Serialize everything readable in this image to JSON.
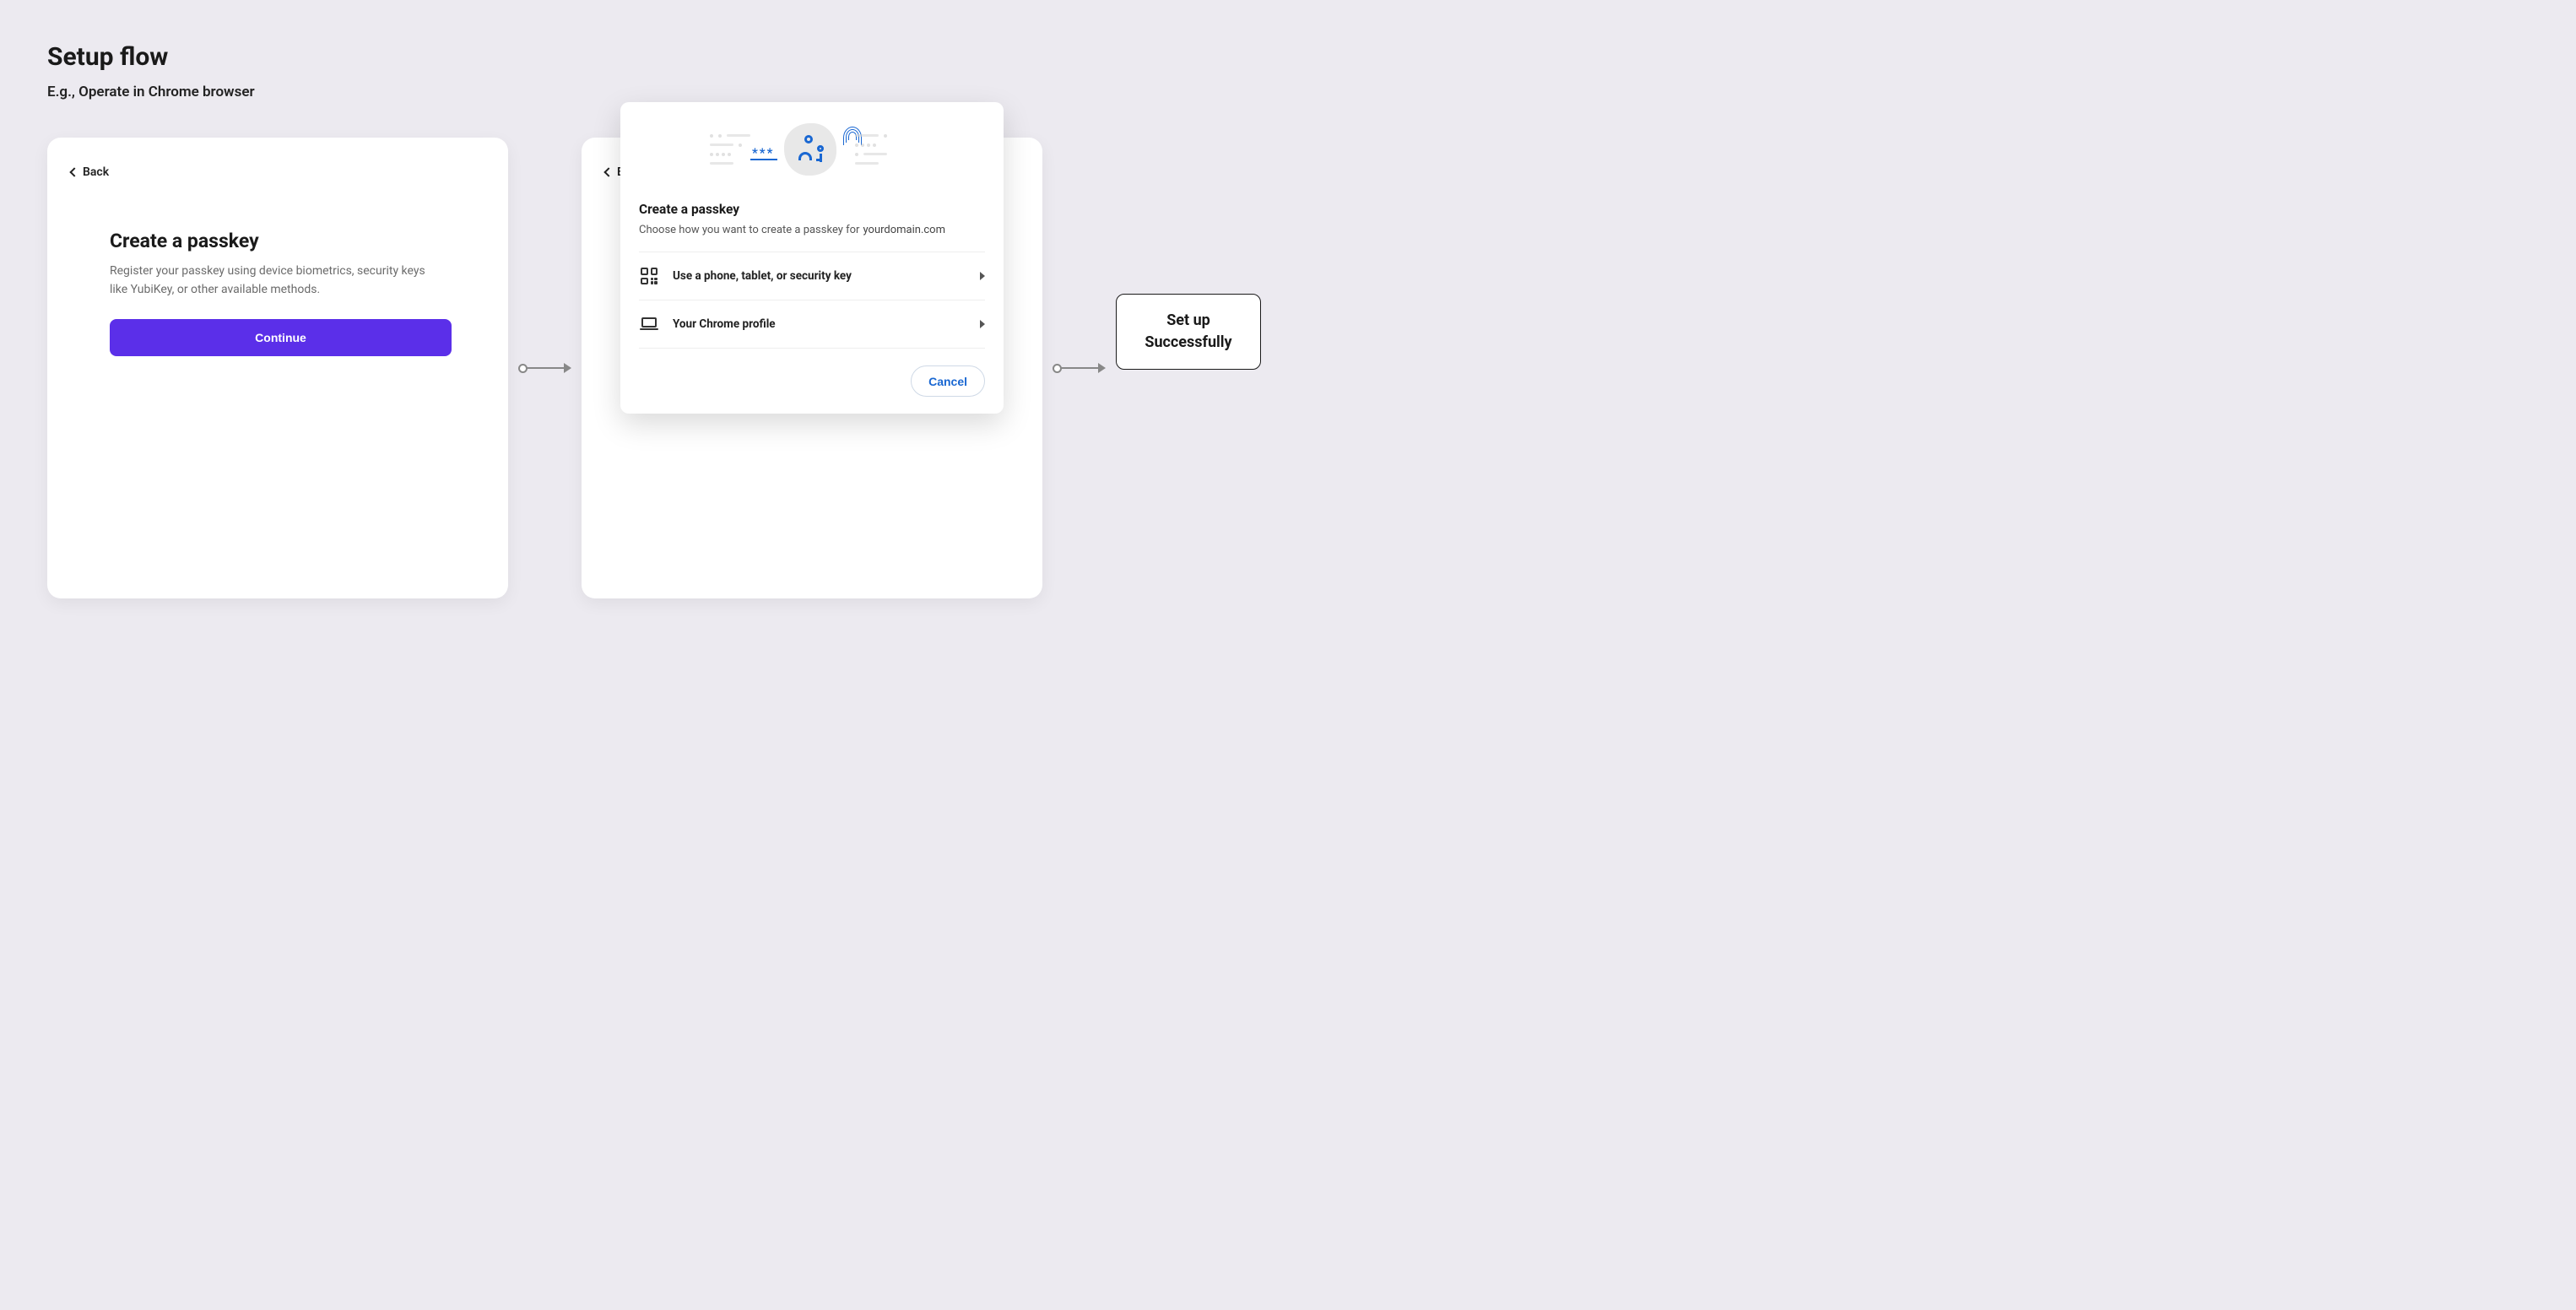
{
  "header": {
    "title": "Setup flow",
    "subtitle": "E.g., Operate in Chrome browser"
  },
  "card1": {
    "back": "Back",
    "title": "Create a passkey",
    "description": "Register your passkey using device biometrics, security keys like YubiKey, or other available methods.",
    "button": "Continue"
  },
  "card2": {
    "back": "Back"
  },
  "overlay": {
    "title": "Create a passkey",
    "description_prefix": "Choose how you want to create a passkey for",
    "domain": "yourdomain.com",
    "options": [
      {
        "label": "Use a phone, tablet, or security key",
        "icon": "qr-scan-icon"
      },
      {
        "label": "Your Chrome profile",
        "icon": "laptop-icon"
      }
    ],
    "cancel": "Cancel"
  },
  "success": {
    "text": "Set up\nSuccessfully"
  }
}
